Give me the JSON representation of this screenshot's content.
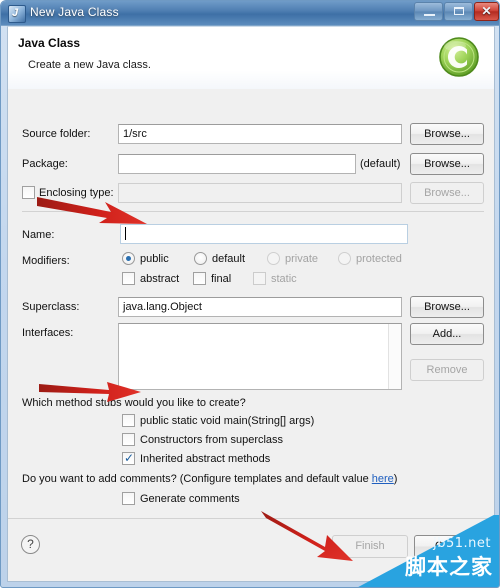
{
  "window": {
    "title": "New Java Class",
    "icon": "java-class-icon",
    "controls": {
      "minimize": "minimize-button",
      "maximize": "maximize-button",
      "close_label": "✕"
    }
  },
  "header": {
    "title": "Java Class",
    "description": "Create a new Java class.",
    "icon": "new-class-green-c-icon"
  },
  "form": {
    "source_folder": {
      "label": "Source folder:",
      "value": "1/src",
      "button": "Browse..."
    },
    "package": {
      "label": "Package:",
      "value": "",
      "suffix": "(default)",
      "button": "Browse..."
    },
    "enclosing_type": {
      "label": "Enclosing type:",
      "checked": false,
      "value": "",
      "button": "Browse..."
    },
    "name": {
      "label": "Name:",
      "value": ""
    },
    "modifiers": {
      "label": "Modifiers:",
      "radios": [
        {
          "label": "public",
          "selected": true,
          "enabled": true
        },
        {
          "label": "default",
          "selected": false,
          "enabled": true
        },
        {
          "label": "private",
          "selected": false,
          "enabled": false
        },
        {
          "label": "protected",
          "selected": false,
          "enabled": false
        }
      ],
      "checkboxes": [
        {
          "label": "abstract",
          "checked": false,
          "enabled": true
        },
        {
          "label": "final",
          "checked": false,
          "enabled": true
        },
        {
          "label": "static",
          "checked": false,
          "enabled": false
        }
      ]
    },
    "superclass": {
      "label": "Superclass:",
      "value": "java.lang.Object",
      "button": "Browse..."
    },
    "interfaces": {
      "label": "Interfaces:",
      "items": [],
      "add_button": "Add...",
      "remove_button": "Remove"
    },
    "method_stubs": {
      "question": "Which method stubs would you like to create?",
      "options": [
        {
          "label": "public static void main(String[] args)",
          "checked": false
        },
        {
          "label": "Constructors from superclass",
          "checked": false
        },
        {
          "label": "Inherited abstract methods",
          "checked": true
        }
      ]
    },
    "comments": {
      "question_pre": "Do you want to add comments? (Configure templates and default value ",
      "link": "here",
      "question_post": ")",
      "option": {
        "label": "Generate comments",
        "checked": false
      }
    }
  },
  "buttonbar": {
    "help": "?",
    "finish": "Finish",
    "cancel": "Cancel"
  },
  "annotations": {
    "arrows": [
      {
        "name": "arrow-to-name-field"
      },
      {
        "name": "arrow-to-main-method-checkbox"
      },
      {
        "name": "arrow-to-finish-button"
      }
    ]
  },
  "watermark": {
    "english": "jb51.net",
    "chinese": "脚本之家",
    "color": "#29a3e0"
  }
}
